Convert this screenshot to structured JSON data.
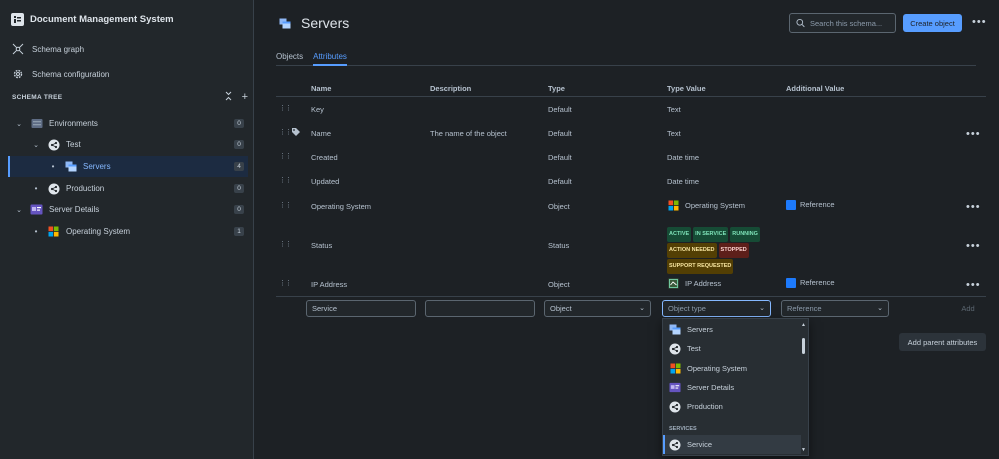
{
  "app": {
    "title": "Document Management System"
  },
  "sidebar": {
    "links": [
      {
        "label": "Schema graph",
        "icon": "schema-graph-icon"
      },
      {
        "label": "Schema configuration",
        "icon": "gear-icon"
      }
    ],
    "tree_title": "SCHEMA TREE",
    "tree": [
      {
        "label": "Environments",
        "count": "0",
        "caret": "expanded",
        "icon": "folder-icon"
      },
      {
        "label": "Test",
        "count": "0",
        "caret": "expanded",
        "icon": "share-icon"
      },
      {
        "label": "Servers",
        "count": "4",
        "caret": "leaf",
        "icon": "servers-icon",
        "selected": true
      },
      {
        "label": "Production",
        "count": "0",
        "caret": "leaf",
        "icon": "share-icon"
      },
      {
        "label": "Server Details",
        "count": "0",
        "caret": "expanded",
        "icon": "server-details-icon"
      },
      {
        "label": "Operating System",
        "count": "1",
        "caret": "leaf",
        "icon": "windows-icon"
      }
    ]
  },
  "header": {
    "title": "Servers",
    "search_placeholder": "Search this schema...",
    "create_label": "Create object"
  },
  "tabs": [
    {
      "label": "Objects",
      "active": false
    },
    {
      "label": "Attributes",
      "active": true
    }
  ],
  "table": {
    "columns": [
      "Name",
      "Description",
      "Type",
      "Type Value",
      "Additional Value"
    ],
    "rows": [
      {
        "name": "Key",
        "description": "",
        "type": "Default",
        "type_value": "Text",
        "additional": ""
      },
      {
        "name": "Name",
        "description": "The name of the object",
        "type": "Default",
        "type_value": "Text",
        "additional": ""
      },
      {
        "name": "Created",
        "description": "",
        "type": "Default",
        "type_value": "Date time",
        "additional": ""
      },
      {
        "name": "Updated",
        "description": "",
        "type": "Default",
        "type_value": "Date time",
        "additional": ""
      },
      {
        "name": "Operating System",
        "description": "",
        "type": "Object",
        "type_value": "Operating System",
        "additional": "Reference"
      },
      {
        "name": "Status",
        "description": "",
        "type": "Status",
        "type_value": "",
        "additional": ""
      },
      {
        "name": "IP Address",
        "description": "",
        "type": "Object",
        "type_value": "IP Address",
        "additional": "Reference"
      }
    ],
    "status_values": [
      {
        "label": "ACTIVE",
        "color": "green"
      },
      {
        "label": "IN SERVICE",
        "color": "green"
      },
      {
        "label": "RUNNING",
        "color": "green"
      },
      {
        "label": "ACTION NEEDED",
        "color": "yellow"
      },
      {
        "label": "STOPPED",
        "color": "red"
      },
      {
        "label": "SUPPORT REQUESTED",
        "color": "yellow"
      }
    ]
  },
  "new_attribute": {
    "name_value": "Service",
    "description_value": "",
    "type_value": "Object",
    "object_type_placeholder": "Object type",
    "additional_value": "Reference",
    "add_label": "Add"
  },
  "add_parent_label": "Add parent attributes",
  "dropdown": {
    "items": [
      {
        "label": "Servers",
        "icon": "servers-icon"
      },
      {
        "label": "Test",
        "icon": "share-icon"
      },
      {
        "label": "Operating System",
        "icon": "windows-icon"
      },
      {
        "label": "Server Details",
        "icon": "server-details-icon"
      },
      {
        "label": "Production",
        "icon": "share-icon"
      }
    ],
    "group_label": "SERVICES",
    "group_items": [
      {
        "label": "Service",
        "icon": "share-icon"
      }
    ]
  },
  "colors": {
    "accent": "#579dff",
    "background": "#1d2125",
    "sidebar": "#22272b"
  }
}
